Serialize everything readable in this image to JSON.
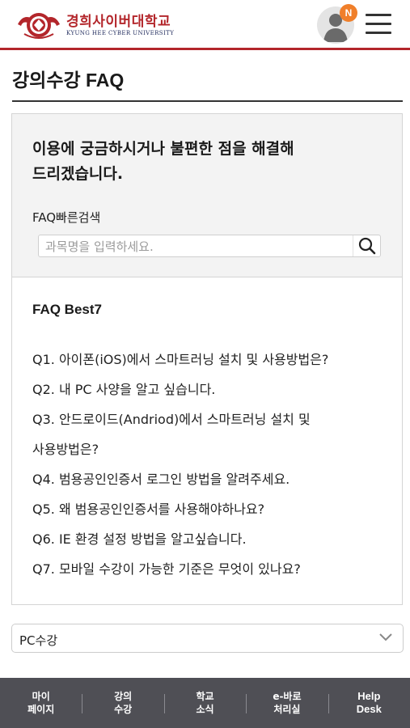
{
  "header": {
    "logo_text_ko": "경희사이버대학교",
    "logo_text_en": "KYUNG HEE CYBER UNIVERSITY",
    "notification_badge": "N",
    "brand_color": "#b3262b",
    "badge_color": "#f07f2a",
    "icons": {
      "user": "user-avatar-icon",
      "menu": "hamburger-menu-icon"
    }
  },
  "page": {
    "title": "강의수강 FAQ"
  },
  "faq": {
    "intro_line1": "이용에 궁금하시거나 불편한 점을 해결해",
    "intro_line2": "드리겠습니다.",
    "quick_search_label": "FAQ빠른검색",
    "search_placeholder": "과목명을 입력하세요.",
    "search_icon": "search-icon",
    "best_title": "FAQ Best7",
    "questions": [
      "Q1. 아이폰(iOS)에서 스마트러닝 설치 및 사용방법은?",
      "Q2. 내 PC 사양을 알고 싶습니다.",
      "Q3. 안드로이드(Andriod)에서 스마트러닝 설치 및",
      "사용방법은?",
      "Q4. 범용공인인증서 로그인 방법을 알려주세요.",
      "Q5. 왜 범용공인인증서를 사용해야하나요?",
      "Q6. IE 환경 설정 방법을 알고싶습니다.",
      "Q7. 모바일 수강이 가능한 기준은 무엇이 있나요?"
    ]
  },
  "category_select": {
    "selected": "PC수강",
    "icon": "chevron-down-icon"
  },
  "bottom_nav": {
    "background": "#4f4f55",
    "items": [
      {
        "label": "마이\n페이지"
      },
      {
        "label": "강의\n수강"
      },
      {
        "label": "학교\n소식"
      },
      {
        "label": "e-바로\n처리실"
      },
      {
        "label": "Help\nDesk"
      }
    ]
  }
}
